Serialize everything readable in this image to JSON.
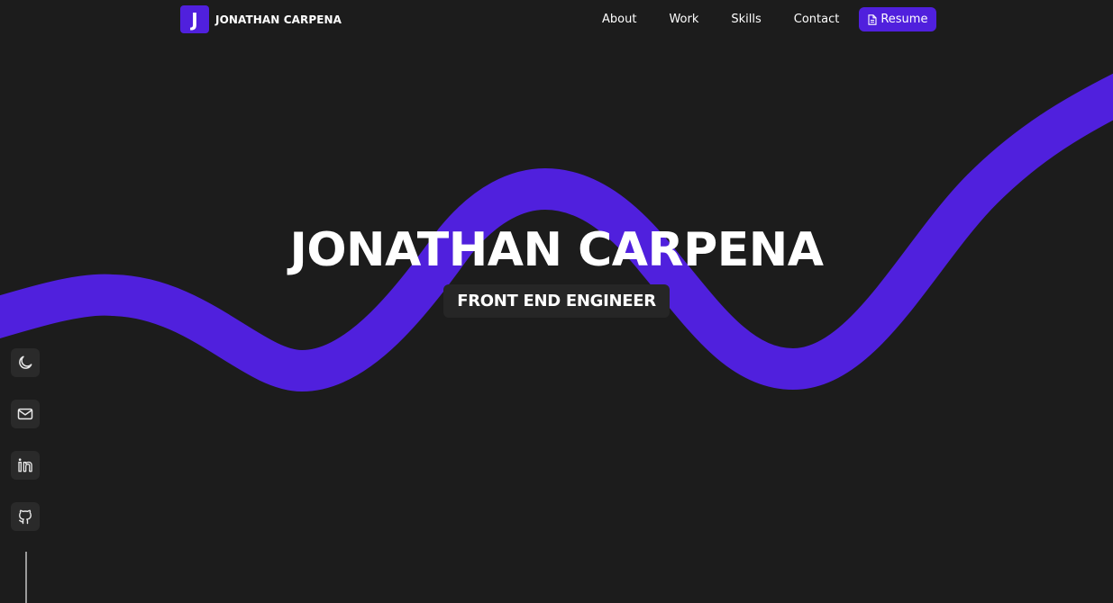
{
  "colors": {
    "background": "#1c1c1c",
    "accent": "#5020dd",
    "badge_bg": "#262626",
    "side_btn_bg": "#2a2a2a"
  },
  "nav": {
    "logo_letter": "J",
    "logo_text": "JONATHAN CARPENA",
    "links": [
      {
        "label": "About"
      },
      {
        "label": "Work"
      },
      {
        "label": "Skills"
      },
      {
        "label": "Contact"
      }
    ],
    "resume": {
      "label": "Resume",
      "icon": "document-icon"
    }
  },
  "hero": {
    "title": "JONATHAN CARPENA",
    "subtitle": "FRONT END ENGINEER"
  },
  "sidebar": {
    "items": [
      {
        "icon": "moon-icon"
      },
      {
        "icon": "mail-icon"
      },
      {
        "icon": "linkedin-icon"
      },
      {
        "icon": "github-icon"
      }
    ]
  }
}
